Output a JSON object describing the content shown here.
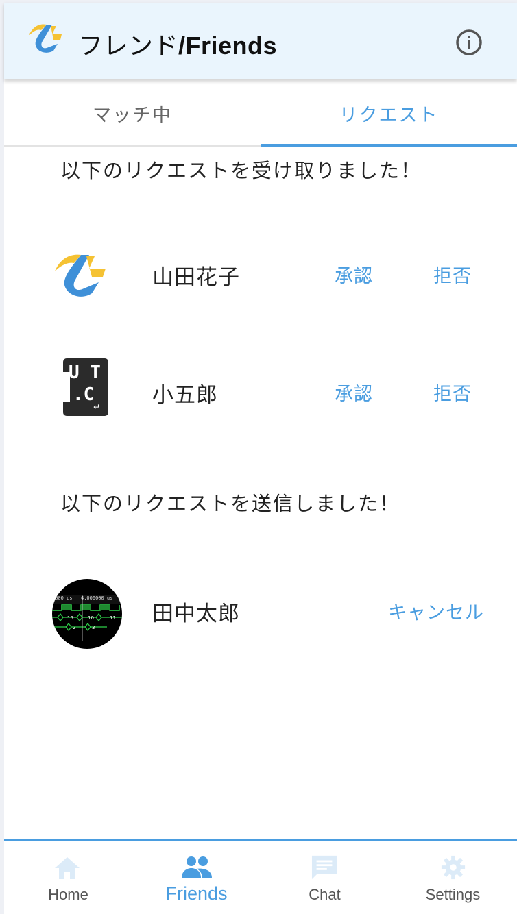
{
  "header": {
    "title_jp": "フレンド",
    "title_en": "/Friends"
  },
  "tabs": [
    {
      "label": "マッチ中",
      "active": false
    },
    {
      "label": "リクエスト",
      "active": true
    }
  ],
  "received": {
    "heading": "以下のリクエストを受け取りました！",
    "items": [
      {
        "name": "山田花子",
        "avatar": "bolt-logo-icon",
        "approve": "承認",
        "reject": "拒否"
      },
      {
        "name": "小五郎",
        "avatar": "utc-keycap-icon",
        "approve": "承認",
        "reject": "拒否"
      }
    ]
  },
  "sent": {
    "heading": "以下のリクエストを送信しました！",
    "items": [
      {
        "name": "田中太郎",
        "avatar": "waveform-photo",
        "cancel": "キャンセル",
        "avatar_text": {
          "t1": "2000 us",
          "t2": "4.000000 us",
          "v1": "15",
          "v2": "10",
          "v3": "11",
          "v4": "2",
          "v5": "3"
        }
      }
    ]
  },
  "utc_key": {
    "top": "U T",
    "bottom": ".C",
    "enter": "↵"
  },
  "nav": [
    {
      "label": "Home",
      "icon": "home-icon",
      "active": false
    },
    {
      "label": "Friends",
      "icon": "people-icon",
      "active": true
    },
    {
      "label": "Chat",
      "icon": "chat-icon",
      "active": false
    },
    {
      "label": "Settings",
      "icon": "gear-icon",
      "active": false
    }
  ],
  "colors": {
    "accent": "#4a9de0",
    "accent_light": "#dcebf8",
    "header_bg": "#eaf5fd",
    "logo_yellow": "#f5c233",
    "logo_blue": "#3f90d8"
  }
}
